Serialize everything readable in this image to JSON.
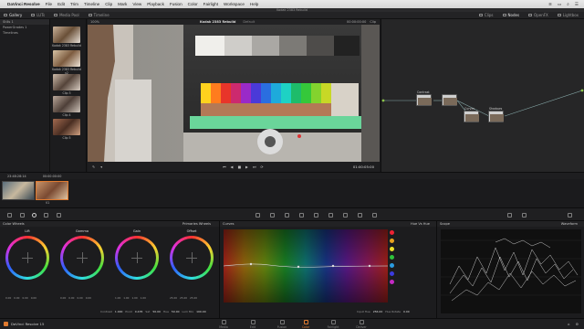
{
  "menubar": {
    "app": "DaVinci Resolve",
    "items": [
      "File",
      "Edit",
      "Trim",
      "Timeline",
      "Clip",
      "Mark",
      "View",
      "Playback",
      "Fusion",
      "Color",
      "Fairlight",
      "Workspace",
      "Help"
    ]
  },
  "window": {
    "title": "Kodak 2383 Rebuild"
  },
  "toolbar": {
    "buttons": [
      "Gallery",
      "LUTs",
      "Media Pool",
      "Timeline"
    ],
    "right_buttons": [
      "Clips",
      "Nodes",
      "OpenFX",
      "Lightbox"
    ]
  },
  "left_panel": {
    "items": [
      "Stills 1",
      "PowerGrades 1",
      "Timelines"
    ]
  },
  "clips": [
    {
      "label": "Kodak 2383 Rebuild"
    },
    {
      "label": "Kodak 2383 Rebuild v2"
    },
    {
      "label": "Clip 3"
    },
    {
      "label": "Clip 4"
    },
    {
      "label": "Clip 5"
    }
  ],
  "viewer": {
    "zoom": "100%",
    "title": "Kodak 2383 Rebuild",
    "status": "Default",
    "timecode_top": "00:00:00:00",
    "clip_label": "Clip",
    "timecode": "01:00:05:00"
  },
  "nodes": {
    "header": "Clip",
    "list": [
      {
        "id": "01",
        "label": "Contrast"
      },
      {
        "id": "02",
        "label": ""
      },
      {
        "id": "03",
        "label": "Curves"
      },
      {
        "id": "04",
        "label": "Shadows"
      }
    ]
  },
  "timeline": {
    "clip_tc": "23:48:28:14",
    "tc": "00:00:00:00",
    "thumbs": [
      {
        "num": "01",
        "tc": "00:00:00:00",
        "tag": "V1"
      },
      {
        "num": "02",
        "tc": "00:00:00:00",
        "tag": "V1"
      }
    ]
  },
  "wheels": {
    "title": "Color Wheels",
    "mode": "Primaries Wheels",
    "items": [
      {
        "name": "Lift",
        "values": [
          "0.00",
          "0.00",
          "0.00",
          "0.00"
        ]
      },
      {
        "name": "Gamma",
        "values": [
          "0.00",
          "0.00",
          "0.00",
          "0.00"
        ]
      },
      {
        "name": "Gain",
        "values": [
          "1.00",
          "1.00",
          "1.00",
          "1.00"
        ]
      },
      {
        "name": "Offset",
        "values": [
          "25.00",
          "25.00",
          "25.00"
        ]
      }
    ],
    "footer": [
      {
        "k": "Contrast",
        "v": "1.000"
      },
      {
        "k": "Pivot",
        "v": "0.435"
      },
      {
        "k": "Sat",
        "v": "50.00"
      },
      {
        "k": "Hue",
        "v": "50.00"
      },
      {
        "k": "Lum Mix",
        "v": "100.00"
      }
    ]
  },
  "curves": {
    "title": "Curves",
    "mode": "Hue Vs Hue",
    "input_hue": "Input Hue",
    "input_val": "256.00",
    "hue_rotate": "Hue Rotate",
    "hue_val": "0.00"
  },
  "scope": {
    "title": "Scope",
    "mode": "Waveform"
  },
  "pages": {
    "app": "DaVinci Resolve 15",
    "tabs": [
      "Media",
      "Edit",
      "Fusion",
      "Color",
      "Fairlight",
      "Deliver"
    ],
    "active": "Color"
  },
  "colors": {
    "accent": "#e07a2f",
    "panel": "#1c1c1e"
  }
}
